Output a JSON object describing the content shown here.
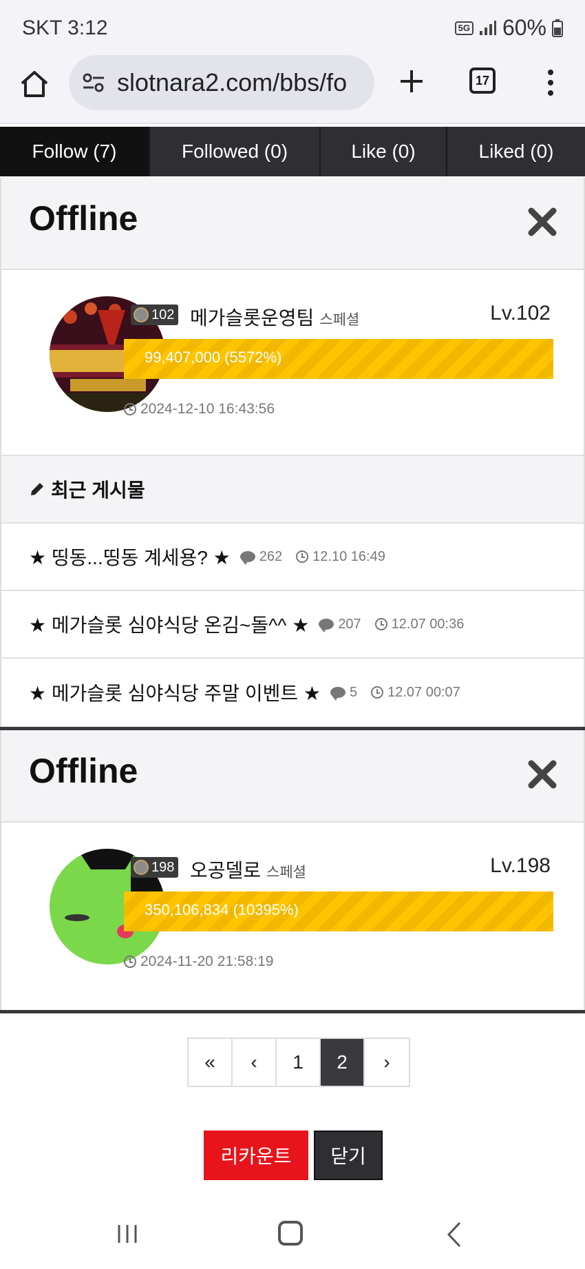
{
  "status_bar": {
    "carrier_time": "SKT 3:12",
    "network": "5G",
    "battery": "60%"
  },
  "browser": {
    "url": "slotnara2.com/bbs/fo",
    "tab_count": "17",
    "icons": [
      "home-icon",
      "site-settings-icon",
      "new-tab-icon",
      "tab-switcher-icon",
      "more-menu-icon"
    ]
  },
  "tabs": [
    {
      "label": "Follow (7)",
      "active": true
    },
    {
      "label": "Followed (0)",
      "active": false
    },
    {
      "label": "Like (0)",
      "active": false
    },
    {
      "label": "Liked (0)",
      "active": false
    }
  ],
  "profiles": [
    {
      "status": "Offline",
      "badge_level": "102",
      "name": "메가슬롯운영팀",
      "role": "스페셜",
      "level": "Lv.102",
      "xp_text": "99,407,000 (5572%)",
      "xp_fill": 1.0,
      "date": "2024-12-10 16:43:56",
      "recent_label": "최근 게시물",
      "posts": [
        {
          "title": "★ 띵동...띵동 계세용? ★",
          "comments": "262",
          "time": "12.10 16:49"
        },
        {
          "title": "★ 메가슬롯 심야식당 온김~돌^^ ★",
          "comments": "207",
          "time": "12.07 00:36"
        },
        {
          "title": "★ 메가슬롯 심야식당 주말 이벤트 ★",
          "comments": "5",
          "time": "12.07 00:07"
        }
      ]
    },
    {
      "status": "Offline",
      "badge_level": "198",
      "name": "오공델로",
      "role": "스페셜",
      "level": "Lv.198",
      "xp_text": "350,106,834 (10395%)",
      "xp_fill": 1.0,
      "date": "2024-11-20 21:58:19"
    }
  ],
  "pagination": {
    "first": "«",
    "prev": "‹",
    "pages": [
      "1",
      "2"
    ],
    "current": "2",
    "next": "›"
  },
  "actions": {
    "recount": "리카운트",
    "close": "닫기"
  },
  "colors": {
    "tab_bg": "#2e2e33",
    "tab_active": "#111111",
    "xp_bar": "#ffc400",
    "recount_btn": "#e8141c",
    "close_btn": "#2e2e33"
  }
}
